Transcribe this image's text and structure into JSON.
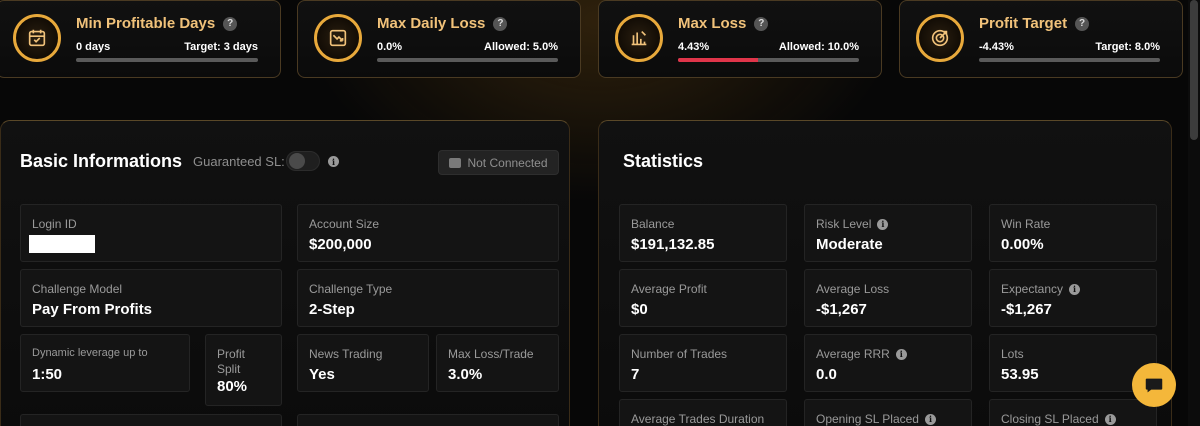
{
  "metrics": [
    {
      "title": "Min Profitable Days",
      "value": "0 days",
      "target": "Target: 3 days",
      "progress": 0,
      "icon": "calendar-icon"
    },
    {
      "title": "Max Daily Loss",
      "value": "0.0%",
      "target": "Allowed: 5.0%",
      "progress": 0,
      "icon": "chart-down-icon"
    },
    {
      "title": "Max Loss",
      "value": "4.43%",
      "target": "Allowed: 10.0%",
      "progress": 0.443,
      "icon": "bars-down-icon"
    },
    {
      "title": "Profit Target",
      "value": "-4.43%",
      "target": "Target: 8.0%",
      "progress": 0,
      "icon": "target-icon"
    }
  ],
  "basic": {
    "title": "Basic Informations",
    "guaranteed_sl_label": "Guaranteed SL:",
    "guaranteed_sl_on": false,
    "not_connected_label": "Not Connected",
    "login_id_label": "Login ID",
    "account_size_label": "Account Size",
    "account_size": "$200,000",
    "challenge_model_label": "Challenge Model",
    "challenge_model": "Pay From Profits",
    "challenge_type_label": "Challenge Type",
    "challenge_type": "2-Step",
    "leverage_label": "Dynamic leverage up to",
    "leverage": "1:50",
    "profit_split_label": "Profit Split",
    "profit_split": "80%",
    "news_trading_label": "News Trading",
    "news_trading": "Yes",
    "max_loss_trade_label": "Max Loss/Trade",
    "max_loss_trade": "3.0%"
  },
  "stats": {
    "title": "Statistics",
    "items": [
      {
        "label": "Balance",
        "value": "$191,132.85",
        "info": false
      },
      {
        "label": "Risk Level",
        "value": "Moderate",
        "info": true
      },
      {
        "label": "Win Rate",
        "value": "0.00%",
        "info": false
      },
      {
        "label": "Average Profit",
        "value": "$0",
        "info": false
      },
      {
        "label": "Average Loss",
        "value": "-$1,267",
        "info": false
      },
      {
        "label": "Expectancy",
        "value": "-$1,267",
        "info": true
      },
      {
        "label": "Number of Trades",
        "value": "7",
        "info": false
      },
      {
        "label": "Average RRR",
        "value": "0.0",
        "info": true
      },
      {
        "label": "Lots",
        "value": "53.95",
        "info": false
      },
      {
        "label": "Average Trades Duration",
        "value": "",
        "info": false
      },
      {
        "label": "Opening SL Placed",
        "value": "",
        "info": true
      },
      {
        "label": "Closing SL Placed",
        "value": "",
        "info": true
      }
    ]
  },
  "colors": {
    "accent": "#f1c27a",
    "gold": "#e8a93b",
    "danger": "#e0354a",
    "chat": "#f4b73a"
  }
}
